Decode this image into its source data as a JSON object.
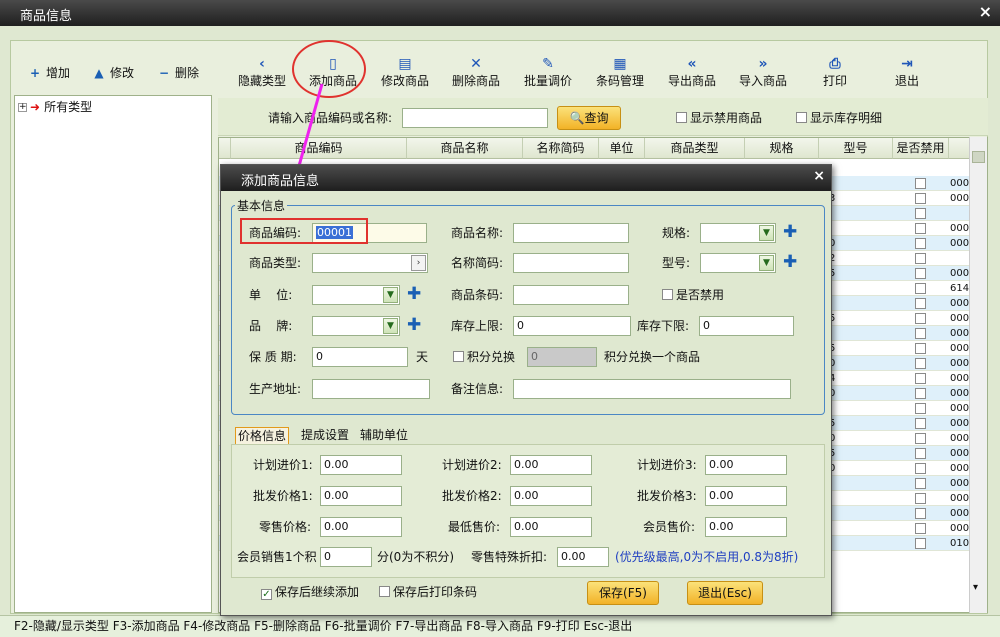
{
  "window": {
    "title": "商品信息",
    "close": "×"
  },
  "left_toolbar": {
    "add": "增加",
    "edit": "修改",
    "delete": "删除",
    "add_icon": "plus-icon",
    "edit_icon": "triangle-up-icon",
    "delete_icon": "minus-icon"
  },
  "tree": {
    "root": "所有类型",
    "expander": "+"
  },
  "toolbar": {
    "buttons": [
      {
        "label": "隐藏类型",
        "icon": "‹"
      },
      {
        "label": "添加商品",
        "icon": "▯"
      },
      {
        "label": "修改商品",
        "icon": "▤"
      },
      {
        "label": "删除商品",
        "icon": "✕"
      },
      {
        "label": "批量调价",
        "icon": "✎"
      },
      {
        "label": "条码管理",
        "icon": "▦"
      },
      {
        "label": "导出商品",
        "icon": "«"
      },
      {
        "label": "导入商品",
        "icon": "»"
      },
      {
        "label": "打印",
        "icon": "⎙"
      },
      {
        "label": "退出",
        "icon": "⇥"
      }
    ]
  },
  "search": {
    "prompt": "请输入商品编码或名称:",
    "value": "",
    "query_button": "查询",
    "show_disabled": "显示禁用商品",
    "show_stock": "显示库存明细"
  },
  "grid": {
    "headers": [
      "商品编码",
      "商品名称",
      "名称简码",
      "单位",
      "商品类型",
      "规格",
      "型号",
      "是否禁用"
    ],
    "fragments": [
      "",
      "3",
      "",
      "",
      "0",
      "2",
      "5",
      "",
      "",
      "5",
      "",
      "5",
      "0",
      "4",
      "0",
      "",
      "5",
      "0",
      "5",
      "0",
      "",
      "",
      "",
      "",
      ""
    ],
    "codes": [
      "000",
      "000",
      "",
      "000",
      "000",
      "",
      "000",
      "614",
      "000",
      "000",
      "000",
      "000",
      "000",
      "000",
      "000",
      "000",
      "000",
      "000",
      "000",
      "000",
      "000",
      "000",
      "000",
      "000",
      "010"
    ]
  },
  "status_bar": "F2-隐藏/显示类型  F3-添加商品 F4-修改商品 F5-删除商品 F6-批量调价 F7-导出商品 F8-导入商品 F9-打印 Esc-退出",
  "dialog": {
    "title": "添加商品信息",
    "close": "×",
    "basic_group": "基本信息",
    "fields": {
      "code_label": "商品编码:",
      "code_value": "00001",
      "name_label": "商品名称:",
      "name_value": "",
      "spec_label": "规格:",
      "type_label": "商品类型:",
      "abbr_label": "名称简码:",
      "model_label": "型号:",
      "unit_label": "单    位:",
      "barcode_label": "商品条码:",
      "disabled_label": "是否禁用",
      "brand_label": "品    牌:",
      "stock_upper_label": "库存上限:",
      "stock_upper_value": "0",
      "stock_lower_label": "库存下限:",
      "stock_lower_value": "0",
      "shelf_label": "保 质 期:",
      "shelf_value": "0",
      "shelf_unit": "天",
      "points_label": "积分兑换",
      "points_value": "0",
      "points_desc": "积分兑换一个商品",
      "address_label": "生产地址:",
      "remark_label": "备注信息:"
    },
    "tabs": [
      "价格信息",
      "提成设置",
      "辅助单位"
    ],
    "prices": {
      "plan1_label": "计划进价1:",
      "plan1": "0.00",
      "plan2_label": "计划进价2:",
      "plan2": "0.00",
      "plan3_label": "计划进价3:",
      "plan3": "0.00",
      "wh1_label": "批发价格1:",
      "wh1": "0.00",
      "wh2_label": "批发价格2:",
      "wh2": "0.00",
      "wh3_label": "批发价格3:",
      "wh3": "0.00",
      "retail_label": "零售价格:",
      "retail": "0.00",
      "min_label": "最低售价:",
      "min": "0.00",
      "member_label": "会员售价:",
      "member": "0.00",
      "member_points_label": "会员销售1个积",
      "member_points": "0",
      "member_points_suffix": "分(0为不积分)",
      "discount_label": "零售特殊折扣:",
      "discount": "0.00",
      "discount_note": "(优先级最高,0为不启用,0.8为8折)"
    },
    "continue_add": "保存后继续添加",
    "print_barcode": "保存后打印条码",
    "save_button": "保存(F5)",
    "exit_button": "退出(Esc)"
  },
  "colors": {
    "accent_blue": "#1a5fb4",
    "annotation_red": "#e0322e",
    "annotation_arrow": "#ee22ee"
  }
}
